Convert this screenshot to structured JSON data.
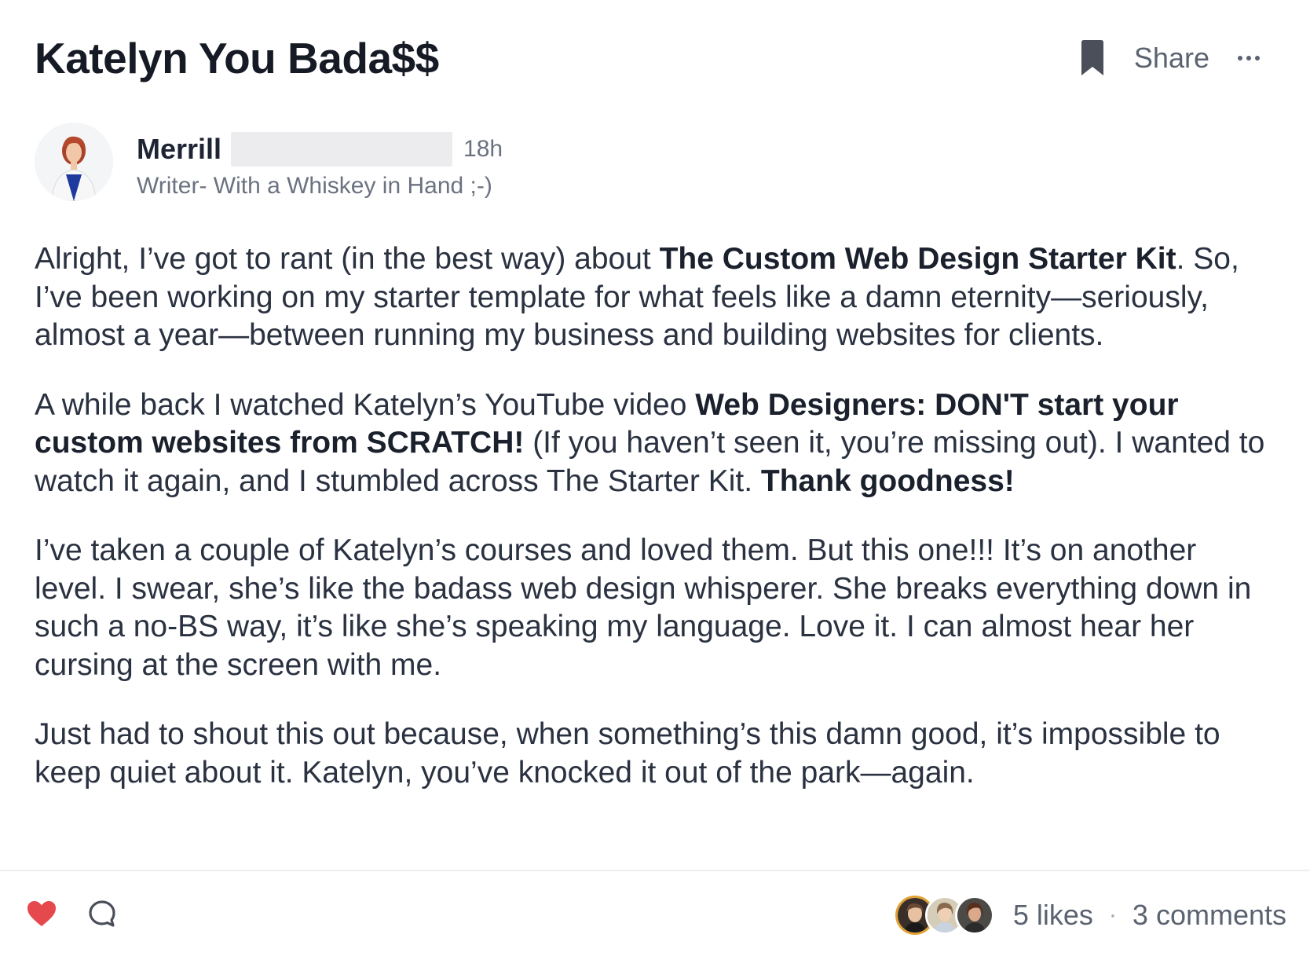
{
  "post": {
    "title": "Katelyn You Bada$$",
    "share_label": "Share",
    "author": {
      "name": "Merrill",
      "time": "18h",
      "bio": "Writer- With a Whiskey in Hand ;-)"
    },
    "paragraphs": [
      {
        "p1a": "Alright, I’ve got to rant (in the best way) about ",
        "p1b": "The Custom Web Design Starter Kit",
        "p1c": ". So, I’ve been working on my starter template for what feels like a damn eternity—seriously, almost a year—between running my business and building websites for clients."
      },
      {
        "p2a": "A while back I watched Katelyn’s YouTube video ",
        "p2b": "Web Designers: DON'T start your custom websites from SCRATCH!",
        "p2c": " (If you haven’t seen it, you’re missing out). I wanted to watch it again, and I stumbled across The Starter Kit. ",
        "p2d": "Thank goodness!"
      },
      {
        "text": "I’ve taken a couple of Katelyn’s courses and loved them. But this one!!! It’s on another level. I swear, she’s like the badass web design whisperer.  She breaks everything down in such a no-BS way, it’s like she’s speaking my language. Love it. I can almost hear her cursing at the screen with me."
      },
      {
        "text": "Just had to shout this out because, when something’s this damn good, it’s impossible to keep quiet about it. Katelyn, you’ve knocked it out of the park—again."
      }
    ],
    "stats": {
      "likes": "5 likes",
      "separator": "·",
      "comments": "3 comments"
    }
  },
  "icons": {
    "bookmark": "bookmark-icon",
    "more": "more-options-icon",
    "like": "heart-icon",
    "comment": "comment-bubble-icon"
  },
  "colors": {
    "heart": "#e5484d",
    "text": "#2a3140",
    "muted": "#5b6270",
    "bookmark": "#4a4f5a"
  }
}
